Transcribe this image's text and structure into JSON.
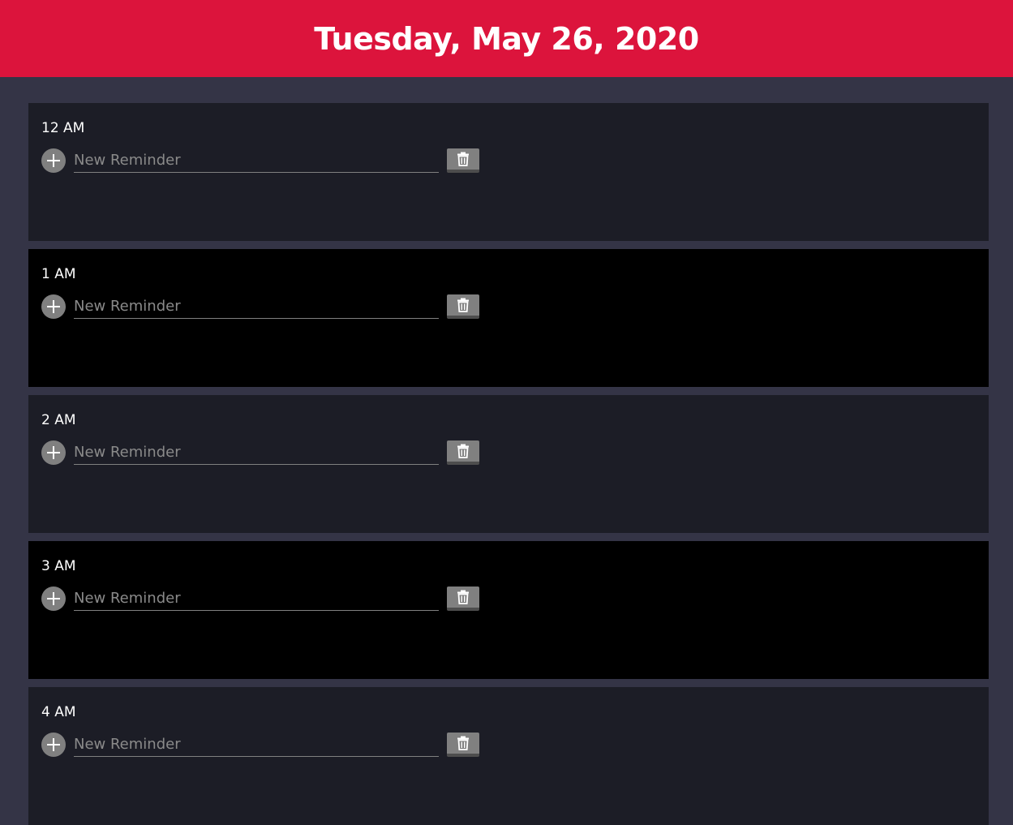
{
  "header": {
    "title": "Tuesday, May 26, 2020"
  },
  "reminder": {
    "placeholder": "New Reminder"
  },
  "hours": [
    {
      "label": "12 AM"
    },
    {
      "label": "1 AM"
    },
    {
      "label": "2 AM"
    },
    {
      "label": "3 AM"
    },
    {
      "label": "4 AM"
    }
  ],
  "icons": {
    "add": "plus-icon",
    "delete": "trash-icon"
  },
  "colors": {
    "header": "#dc143c",
    "page_background": "#343446",
    "block_even": "#1c1d26",
    "block_odd": "#000000",
    "button": "#808080"
  }
}
